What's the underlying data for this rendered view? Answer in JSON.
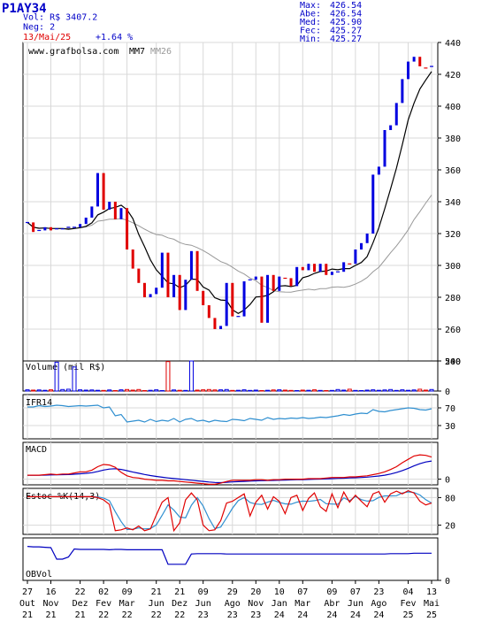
{
  "header": {
    "ticker": "P1AY34",
    "volume": "Vol: R$ 3407.2",
    "trades": "Neg: 2",
    "date": "13/Mai/25",
    "change": "+1.64 %",
    "stats": [
      {
        "label": "Max:",
        "value": "426.54"
      },
      {
        "label": "Abe:",
        "value": "426.54"
      },
      {
        "label": "Med:",
        "value": "425.90"
      },
      {
        "label": "Fec:",
        "value": "425.27"
      },
      {
        "label": "Min:",
        "value": "425.27"
      }
    ]
  },
  "colors": {
    "up": "#0000e0",
    "down": "#e00000",
    "frame": "#000000",
    "grid": "#d8d8d8",
    "header_blue": "#0000c8",
    "ma7": "#000000",
    "ma26": "#999999",
    "ifr": "#2f8fd0",
    "macd": "#e00000",
    "signal": "#0000c0",
    "stoch_k": "#e00000",
    "stoch_d": "#2f8fd0",
    "obv": "#0000c0"
  },
  "chart_data": [
    {
      "type": "candlestick",
      "watermark": "www.grafbolsa.com",
      "legend": [
        "MM7",
        "MM26"
      ],
      "ylim": [
        240,
        440
      ],
      "yticks": [
        240,
        260,
        280,
        300,
        320,
        340,
        360,
        380,
        400,
        420,
        440
      ],
      "x_tick_labels": [
        {
          "day": "27",
          "month": "Out",
          "year": "21"
        },
        {
          "day": "16",
          "month": "Nov",
          "year": "21"
        },
        {
          "day": "22",
          "month": "Dez",
          "year": "21"
        },
        {
          "day": "02",
          "month": "Fev",
          "year": "22"
        },
        {
          "day": "09",
          "month": "Mar",
          "year": "22"
        },
        {
          "day": "21",
          "month": "Jun",
          "year": "22"
        },
        {
          "day": "21",
          "month": "Dez",
          "year": "22"
        },
        {
          "day": "09",
          "month": "Jun",
          "year": "23"
        },
        {
          "day": "29",
          "month": "Ago",
          "year": "23"
        },
        {
          "day": "20",
          "month": "Nov",
          "year": "23"
        },
        {
          "day": "10",
          "month": "Jan",
          "year": "24"
        },
        {
          "day": "07",
          "month": "Mar",
          "year": "24"
        },
        {
          "day": "09",
          "month": "Abr",
          "year": "24"
        },
        {
          "day": "07",
          "month": "Jun",
          "year": "24"
        },
        {
          "day": "23",
          "month": "Ago",
          "year": "24"
        },
        {
          "day": "04",
          "month": "Fev",
          "year": "25"
        },
        {
          "day": "13",
          "month": "Mai",
          "year": "25"
        }
      ],
      "close": [
        327,
        321,
        322,
        324,
        322,
        323,
        323,
        324,
        324,
        326,
        330,
        337,
        358,
        335,
        340,
        329,
        336,
        310,
        298,
        289,
        280,
        282,
        286,
        308,
        280,
        294,
        272,
        291,
        309,
        284,
        275,
        267,
        260,
        262,
        289,
        268,
        268,
        290,
        291,
        293,
        264,
        294,
        284,
        293,
        292,
        287,
        299,
        297,
        301,
        296,
        301,
        294,
        296,
        296,
        302,
        301,
        310,
        314,
        320,
        357,
        362,
        385,
        388,
        402,
        417,
        428,
        431,
        425,
        424,
        425
      ]
    },
    {
      "type": "bar",
      "title": "Volume (mil R$)",
      "ylim": [
        0,
        500
      ],
      "yticks": [
        500,
        0
      ],
      "values": [
        20,
        15,
        18,
        12,
        20,
        480,
        25,
        30,
        400,
        20,
        15,
        18,
        12,
        10,
        18,
        8,
        20,
        25,
        15,
        25,
        8,
        12,
        20,
        8,
        490,
        18,
        12,
        10,
        500,
        15,
        20,
        25,
        18,
        20,
        25,
        10,
        12,
        20,
        10,
        15,
        8,
        12,
        18,
        20,
        15,
        10,
        8,
        15,
        12,
        20,
        10,
        8,
        10,
        25,
        15,
        30,
        10,
        8,
        15,
        20,
        12,
        18,
        25,
        10,
        20,
        12,
        18,
        30,
        15,
        25
      ]
    },
    {
      "type": "line",
      "title": "IFR14",
      "ylim": [
        0,
        100
      ],
      "yticks": [
        70,
        30
      ],
      "values": [
        72,
        72,
        75,
        73,
        74,
        76,
        75,
        73,
        74,
        75,
        74,
        75,
        76,
        70,
        72,
        52,
        55,
        38,
        40,
        42,
        38,
        44,
        39,
        42,
        40,
        46,
        38,
        44,
        46,
        40,
        42,
        38,
        42,
        40,
        39,
        44,
        43,
        41,
        46,
        44,
        42,
        48,
        44,
        46,
        45,
        47,
        46,
        48,
        46,
        47,
        49,
        48,
        50,
        52,
        55,
        53,
        56,
        58,
        57,
        66,
        62,
        61,
        64,
        66,
        68,
        70,
        69,
        66,
        65,
        68
      ]
    },
    {
      "type": "line",
      "title": "MACD",
      "ylim": [
        -10,
        65
      ],
      "yticks": [
        0
      ],
      "macd": [
        7,
        7,
        7,
        8,
        9,
        8,
        9,
        9,
        11,
        13,
        13,
        16,
        22,
        26,
        25,
        21,
        12,
        6,
        3,
        2,
        0,
        -1,
        -2,
        -2,
        -3,
        -3,
        -4,
        -5,
        -6,
        -7,
        -8,
        -9,
        -9,
        -7,
        -4,
        -2,
        -2,
        -2,
        -2,
        -1,
        -1,
        -2,
        -1,
        -1,
        0,
        0,
        0,
        0,
        1,
        1,
        1,
        2,
        3,
        3,
        3,
        4,
        4,
        5,
        6,
        8,
        10,
        13,
        17,
        22,
        29,
        35,
        41,
        43,
        42,
        39
      ]
    },
    {
      "type": "line",
      "title": "Estoc %K(14,3)",
      "ylim": [
        0,
        100
      ],
      "yticks": [
        80,
        20
      ],
      "k": [
        82,
        82,
        82,
        82,
        82,
        82,
        82,
        82,
        82,
        82,
        82,
        82,
        80,
        75,
        65,
        8,
        10,
        14,
        10,
        18,
        8,
        12,
        42,
        70,
        80,
        8,
        25,
        75,
        90,
        75,
        20,
        8,
        10,
        30,
        68,
        72,
        80,
        88,
        40,
        70,
        85,
        55,
        82,
        72,
        45,
        80,
        85,
        52,
        78,
        90,
        60,
        50,
        88,
        58,
        92,
        70,
        85,
        72,
        60,
        88,
        93,
        70,
        88,
        94,
        88,
        95,
        90,
        72,
        64,
        68
      ]
    },
    {
      "type": "line",
      "title": "OBVol",
      "ylim": [
        0,
        100
      ],
      "yticks": [
        0
      ],
      "values": [
        80,
        79,
        79,
        78,
        77,
        50,
        50,
        55,
        74,
        73,
        73,
        73,
        73,
        73,
        72,
        73,
        73,
        72,
        72,
        72,
        72,
        72,
        72,
        72,
        38,
        38,
        38,
        38,
        62,
        63,
        63,
        63,
        63,
        63,
        62,
        62,
        62,
        62,
        62,
        62,
        62,
        62,
        62,
        62,
        62,
        62,
        62,
        62,
        62,
        62,
        62,
        62,
        62,
        62,
        62,
        62,
        62,
        62,
        62,
        62,
        62,
        62,
        63,
        63,
        63,
        63,
        64,
        64,
        64,
        64
      ]
    }
  ]
}
